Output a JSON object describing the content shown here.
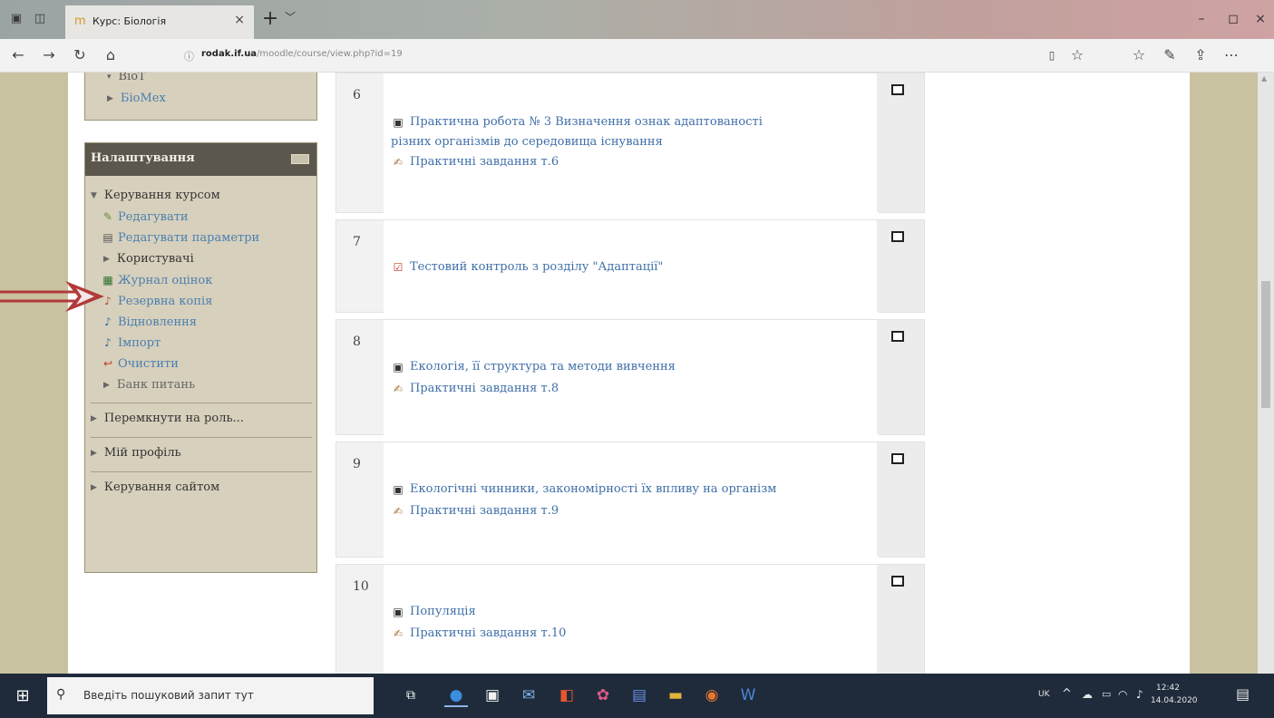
{
  "browser": {
    "tab_title": "Курс: Біологія",
    "tab_close": "×",
    "new_tab": "+",
    "tab_dropdown": "﹀",
    "url_host": "rodak.if.ua",
    "url_path": "/moodle/course/view.php?id=19",
    "window_controls": {
      "minimize": "–",
      "maximize": "◻",
      "close": "×"
    }
  },
  "sidebar": {
    "top_block": {
      "partial_item": "ВіоТ",
      "item": "БіоМех"
    },
    "settings": {
      "title": "Налаштування",
      "course_admin": "Керування курсом",
      "links": [
        {
          "label": "Редагувати",
          "icon": "pencil-icon"
        },
        {
          "label": "Редагувати параметри",
          "icon": "settings-doc-icon"
        },
        {
          "label": "Користувачі",
          "icon": "expand-triangle"
        },
        {
          "label": "Журнал оцінок",
          "icon": "grades-icon"
        },
        {
          "label": "Резервна копія",
          "icon": "backup-icon"
        },
        {
          "label": "Відновлення",
          "icon": "restore-icon"
        },
        {
          "label": "Імпорт",
          "icon": "import-icon"
        },
        {
          "label": "Очистити",
          "icon": "reset-icon"
        },
        {
          "label": "Банк питань",
          "icon": "expand-triangle"
        }
      ],
      "switch_role": "Перемкнути на роль...",
      "my_profile": "Мій профіль",
      "site_admin": "Керування сайтом"
    }
  },
  "sections": [
    {
      "number": "6",
      "activities": [
        {
          "type": "resource",
          "text": "Практична робота № 3 Визначення ознак адаптованості"
        },
        {
          "type": "continuation",
          "text": "різних організмів до середовища існування"
        },
        {
          "type": "assignment",
          "text": "Практичні завдання т.6"
        }
      ]
    },
    {
      "number": "7",
      "activities": [
        {
          "type": "quiz",
          "text": "Тестовий контроль з розділу \"Адаптації\""
        }
      ]
    },
    {
      "number": "8",
      "activities": [
        {
          "type": "resource",
          "text": "Екологія, її структура та методи вивчення"
        },
        {
          "type": "assignment",
          "text": "Практичні завдання т.8"
        }
      ]
    },
    {
      "number": "9",
      "activities": [
        {
          "type": "resource",
          "text": "Екологічні чинники, закономірності їх впливу на організм"
        },
        {
          "type": "assignment",
          "text": "Практичні завдання т.9"
        }
      ]
    },
    {
      "number": "10",
      "activities": [
        {
          "type": "resource",
          "text": "Популяція"
        },
        {
          "type": "assignment",
          "text": "Практичні завдання т.10"
        }
      ]
    }
  ],
  "taskbar": {
    "search_placeholder": "Введіть пошуковий запит тут",
    "language": "UK",
    "time": "12:42",
    "date": "14.04.2020"
  },
  "colors": {
    "link": "#3f6fa8",
    "settings_header": "#5c574c",
    "annotation_arrow": "#b23a3a"
  }
}
